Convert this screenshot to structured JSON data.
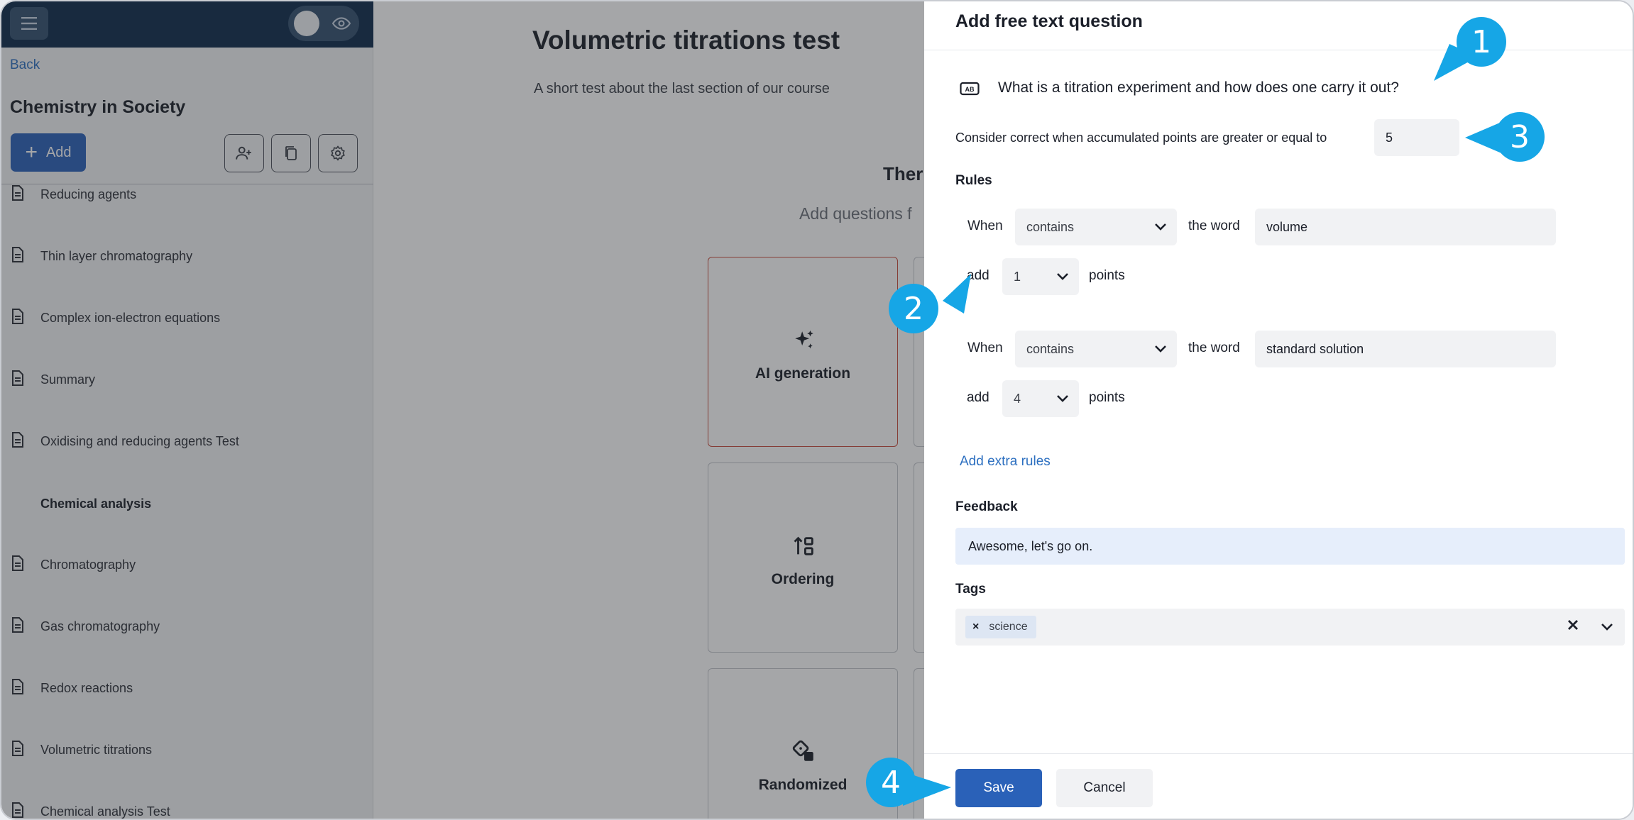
{
  "topbar": {
    "menu_icon": "hamburger-menu-icon",
    "preview_icon": "eye-icon"
  },
  "sidebar": {
    "back_label": "Back",
    "course_title": "Chemistry in Society",
    "add_label": "Add",
    "tool_icons": [
      "users-icon",
      "copy-icon",
      "settings-gear-icon"
    ],
    "items": [
      {
        "label": "Reducing agents",
        "type": "page"
      },
      {
        "label": "Thin layer chromatography",
        "type": "page"
      },
      {
        "label": "Complex ion-electron equations",
        "type": "page"
      },
      {
        "label": "Summary",
        "type": "page"
      },
      {
        "label": "Oxidising and reducing agents Test",
        "type": "page"
      },
      {
        "label": "Chemical analysis",
        "type": "section"
      },
      {
        "label": "Chromatography",
        "type": "page"
      },
      {
        "label": "Gas chromatography",
        "type": "page"
      },
      {
        "label": "Redox reactions",
        "type": "page"
      },
      {
        "label": "Volumetric titrations",
        "type": "page"
      },
      {
        "label": "Chemical analysis Test",
        "type": "page"
      }
    ]
  },
  "main": {
    "test_title": "Volumetric titrations test",
    "test_subtitle": "A short test about the last section of our course",
    "theme_heading_partial": "Ther",
    "add_questions_partial": "Add questions f",
    "question_types": [
      {
        "label": "AI generation",
        "icon": "sparkle-icon",
        "selected": true
      },
      {
        "label": "Ordering",
        "icon": "ordering-icon",
        "selected": false
      },
      {
        "label": "Randomized",
        "icon": "dice-icon",
        "selected": false
      }
    ]
  },
  "drawer": {
    "title": "Add free text question",
    "question_icon": "text-input-icon",
    "question_text": "What is a titration experiment and how does one carry it out?",
    "threshold_label": "Consider correct when accumulated points are greater or equal to",
    "threshold_value": "5",
    "rules_label": "Rules",
    "rules": [
      {
        "when_label": "When",
        "condition": "contains",
        "word_label": "the word",
        "word": "volume",
        "add_label": "add",
        "points": "1",
        "points_label": "points"
      },
      {
        "when_label": "When",
        "condition": "contains",
        "word_label": "the word",
        "word": "standard solution",
        "add_label": "add",
        "points": "4",
        "points_label": "points"
      }
    ],
    "add_extra_rules_label": "Add extra rules",
    "feedback_label": "Feedback",
    "feedback_value": "Awesome, let's go on.",
    "tags_label": "Tags",
    "tags": [
      "science"
    ],
    "save_label": "Save",
    "cancel_label": "Cancel"
  },
  "callouts": [
    "1",
    "2",
    "3",
    "4"
  ],
  "colors": {
    "primary": "#2a61b8",
    "topbar": "#0d2a4b",
    "callout": "#16a6e6",
    "link": "#2c6fc0",
    "feedback_bg": "#e6eefb"
  }
}
